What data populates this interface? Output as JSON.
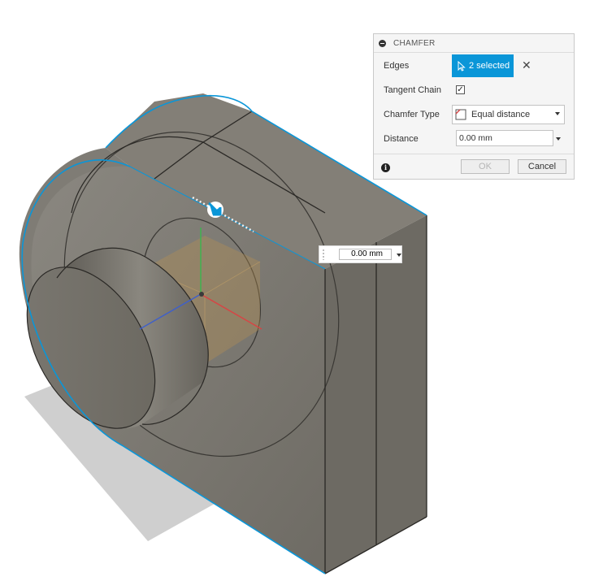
{
  "dialog": {
    "title": "CHAMFER",
    "edges_label": "Edges",
    "edges_value": "2 selected",
    "tangent_chain_label": "Tangent Chain",
    "tangent_chain_checked": true,
    "chamfer_type_label": "Chamfer Type",
    "chamfer_type_value": "Equal distance",
    "distance_label": "Distance",
    "distance_value": "0.00 mm",
    "ok_label": "OK",
    "cancel_label": "Cancel",
    "ok_enabled": false
  },
  "manipulator": {
    "value": "0.00 mm"
  },
  "colors": {
    "selection_blue": "#0a96d8",
    "body_gray": "#75716a",
    "origin_box": "#b9934f"
  }
}
